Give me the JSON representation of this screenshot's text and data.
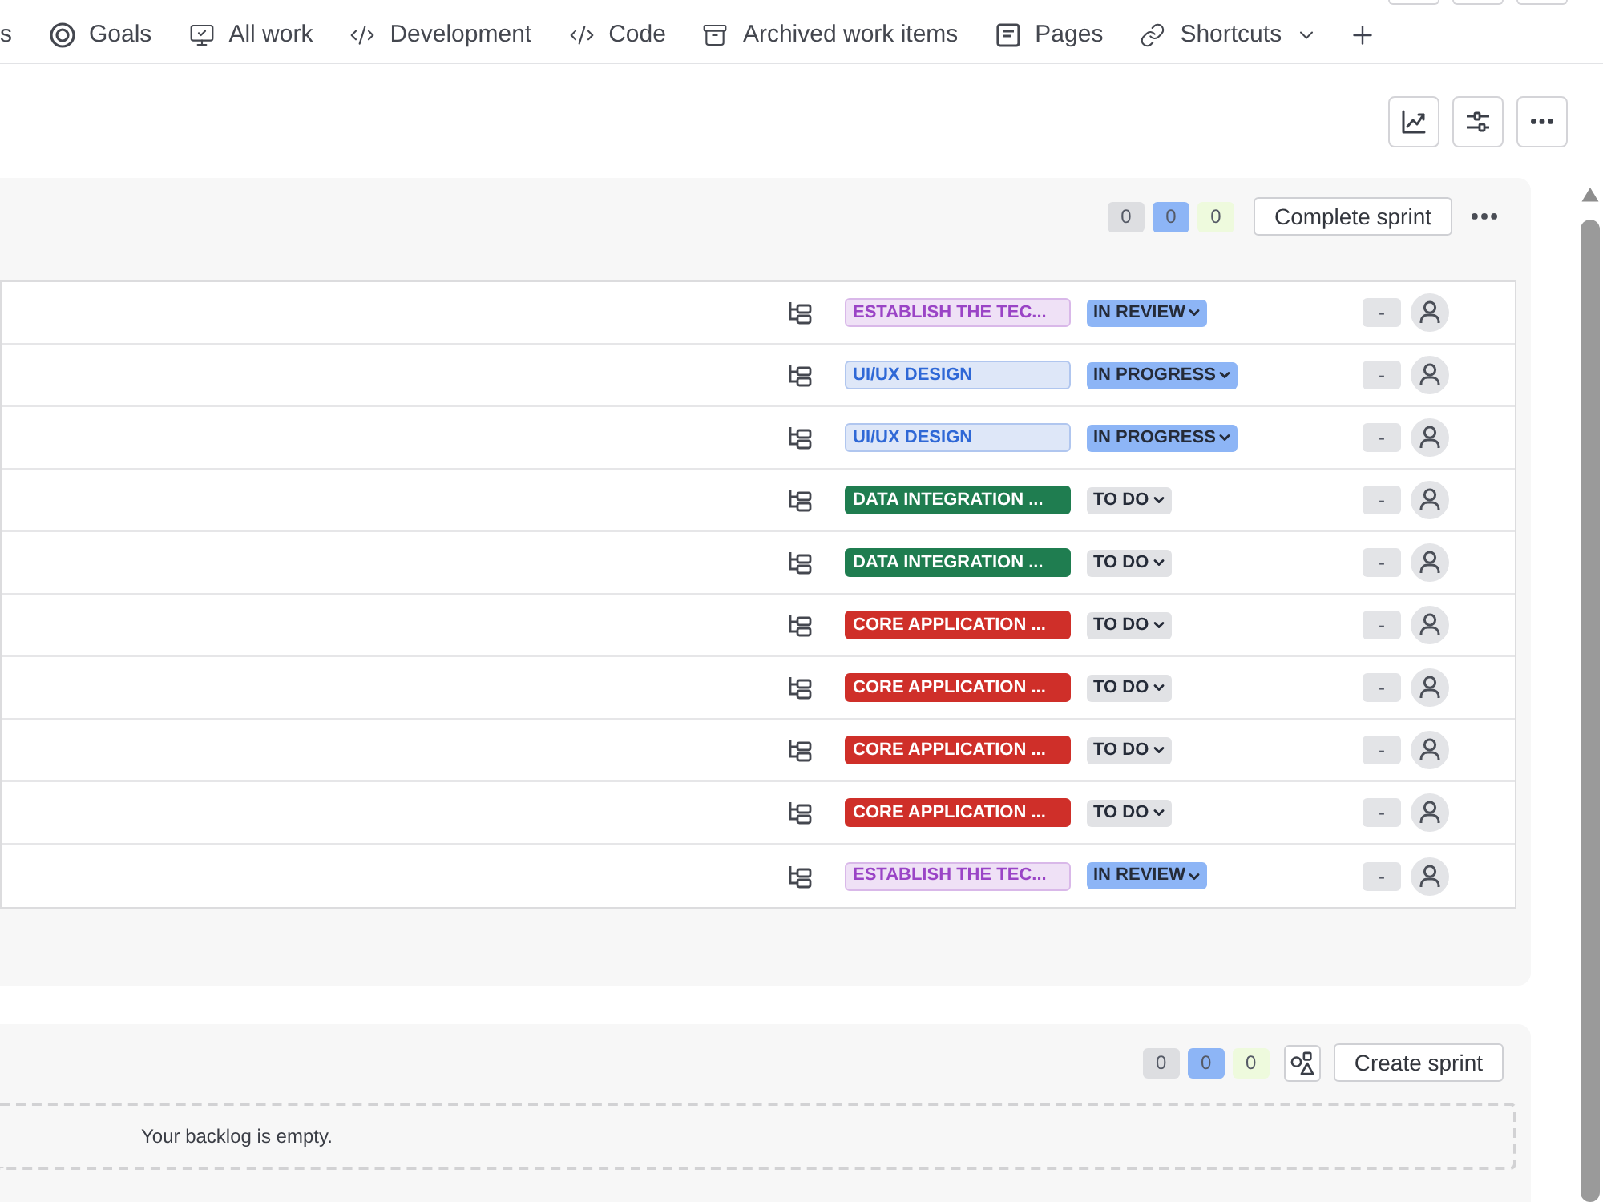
{
  "nav": {
    "tabs": [
      {
        "label": "s"
      },
      {
        "label": "Goals"
      },
      {
        "label": "All work"
      },
      {
        "label": "Development"
      },
      {
        "label": "Code"
      },
      {
        "label": "Archived work items"
      },
      {
        "label": "Pages"
      },
      {
        "label": "Shortcuts"
      }
    ]
  },
  "sprint": {
    "counts": [
      {
        "text": "0",
        "color": "#dddee1"
      },
      {
        "text": "0",
        "color": "#8db5f6"
      },
      {
        "text": "0",
        "color": "#eefadd"
      }
    ],
    "complete_button": "Complete sprint",
    "rows": [
      {
        "label": {
          "text": "ESTABLISH THE TEC...",
          "kind": "subtle",
          "color": "#9a44c6"
        },
        "status": {
          "text": "IN REVIEW",
          "color": "#8db5f6"
        },
        "estimate": "-"
      },
      {
        "label": {
          "text": "UI/UX DESIGN",
          "kind": "subtle",
          "color": "#2f68d6"
        },
        "status": {
          "text": "IN PROGRESS",
          "color": "#8db5f6"
        },
        "estimate": "-"
      },
      {
        "label": {
          "text": "UI/UX DESIGN",
          "kind": "subtle",
          "color": "#2f68d6"
        },
        "status": {
          "text": "IN PROGRESS",
          "color": "#8db5f6"
        },
        "estimate": "-"
      },
      {
        "label": {
          "text": "DATA INTEGRATION ...",
          "kind": "bold",
          "color": "#1f7d50"
        },
        "status": {
          "text": "TO DO",
          "color": "#e1e2e5"
        },
        "estimate": "-"
      },
      {
        "label": {
          "text": "DATA INTEGRATION ...",
          "kind": "bold",
          "color": "#1f7d50"
        },
        "status": {
          "text": "TO DO",
          "color": "#e1e2e5"
        },
        "estimate": "-"
      },
      {
        "label": {
          "text": "CORE APPLICATION ...",
          "kind": "bold",
          "color": "#cf2f29"
        },
        "status": {
          "text": "TO DO",
          "color": "#e1e2e5"
        },
        "estimate": "-"
      },
      {
        "label": {
          "text": "CORE APPLICATION ...",
          "kind": "bold",
          "color": "#cf2f29"
        },
        "status": {
          "text": "TO DO",
          "color": "#e1e2e5"
        },
        "estimate": "-"
      },
      {
        "label": {
          "text": "CORE APPLICATION ...",
          "kind": "bold",
          "color": "#cf2f29"
        },
        "status": {
          "text": "TO DO",
          "color": "#e1e2e5"
        },
        "estimate": "-"
      },
      {
        "label": {
          "text": "CORE APPLICATION ...",
          "kind": "bold",
          "color": "#cf2f29"
        },
        "status": {
          "text": "TO DO",
          "color": "#e1e2e5"
        },
        "estimate": "-"
      },
      {
        "label": {
          "text": "ESTABLISH THE TEC...",
          "kind": "subtle",
          "color": "#9a44c6"
        },
        "status": {
          "text": "IN REVIEW",
          "color": "#8db5f6"
        },
        "estimate": "-"
      }
    ]
  },
  "backlog": {
    "counts": [
      {
        "text": "0",
        "color": "#dddee1"
      },
      {
        "text": "0",
        "color": "#8db5f6"
      },
      {
        "text": "0",
        "color": "#eefadd"
      }
    ],
    "create_button": "Create sprint",
    "empty_text": "Your backlog is empty."
  }
}
